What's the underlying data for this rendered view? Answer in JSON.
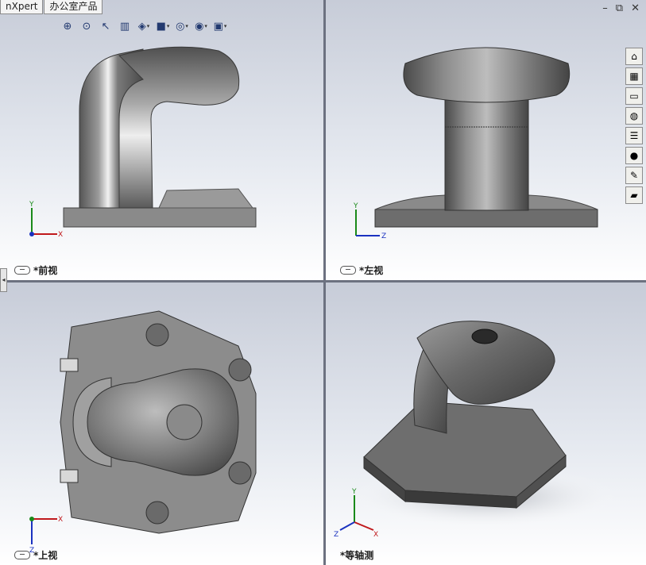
{
  "tabs": [
    {
      "label": "nXpert"
    },
    {
      "label": "办公室产品"
    }
  ],
  "hud_toolbar": [
    {
      "icon": "zoom-to-fit-icon",
      "glyph": "⊕"
    },
    {
      "icon": "zoom-area-icon",
      "glyph": "⊙"
    },
    {
      "icon": "previous-view-icon",
      "glyph": "↖"
    },
    {
      "icon": "section-view-icon",
      "glyph": "▥"
    },
    {
      "icon": "view-orientation-icon",
      "glyph": "◈"
    },
    {
      "icon": "display-style-icon",
      "glyph": "■"
    },
    {
      "icon": "hide-show-items-icon",
      "glyph": "◎"
    },
    {
      "icon": "edit-appearance-icon",
      "glyph": "◉"
    },
    {
      "icon": "apply-scene-icon",
      "glyph": "▣"
    }
  ],
  "window_controls": {
    "minimize": "–",
    "restore": "⧉",
    "close": "✕"
  },
  "task_pane": [
    {
      "icon": "home-icon",
      "glyph": "⌂"
    },
    {
      "icon": "design-library-icon",
      "glyph": "▦"
    },
    {
      "icon": "file-explorer-icon",
      "glyph": "▭"
    },
    {
      "icon": "view-palette-icon",
      "glyph": "◍"
    },
    {
      "icon": "properties-icon",
      "glyph": "☰"
    },
    {
      "icon": "appearances-icon",
      "glyph": "●"
    },
    {
      "icon": "custom-properties-icon",
      "glyph": "✎"
    },
    {
      "icon": "open-folder-icon",
      "glyph": "▰"
    }
  ],
  "viewports": {
    "front": {
      "label": "*前视"
    },
    "left": {
      "label": "*左视"
    },
    "top": {
      "label": "*上视"
    },
    "iso": {
      "label": "*等轴测"
    }
  },
  "axes": {
    "x": "X",
    "y": "Y",
    "z": "Z"
  },
  "colors": {
    "x_axis": "#c0191c",
    "y_axis": "#1a8a1a",
    "z_axis": "#1a32c0",
    "part_metal": "#6c6c6c"
  }
}
